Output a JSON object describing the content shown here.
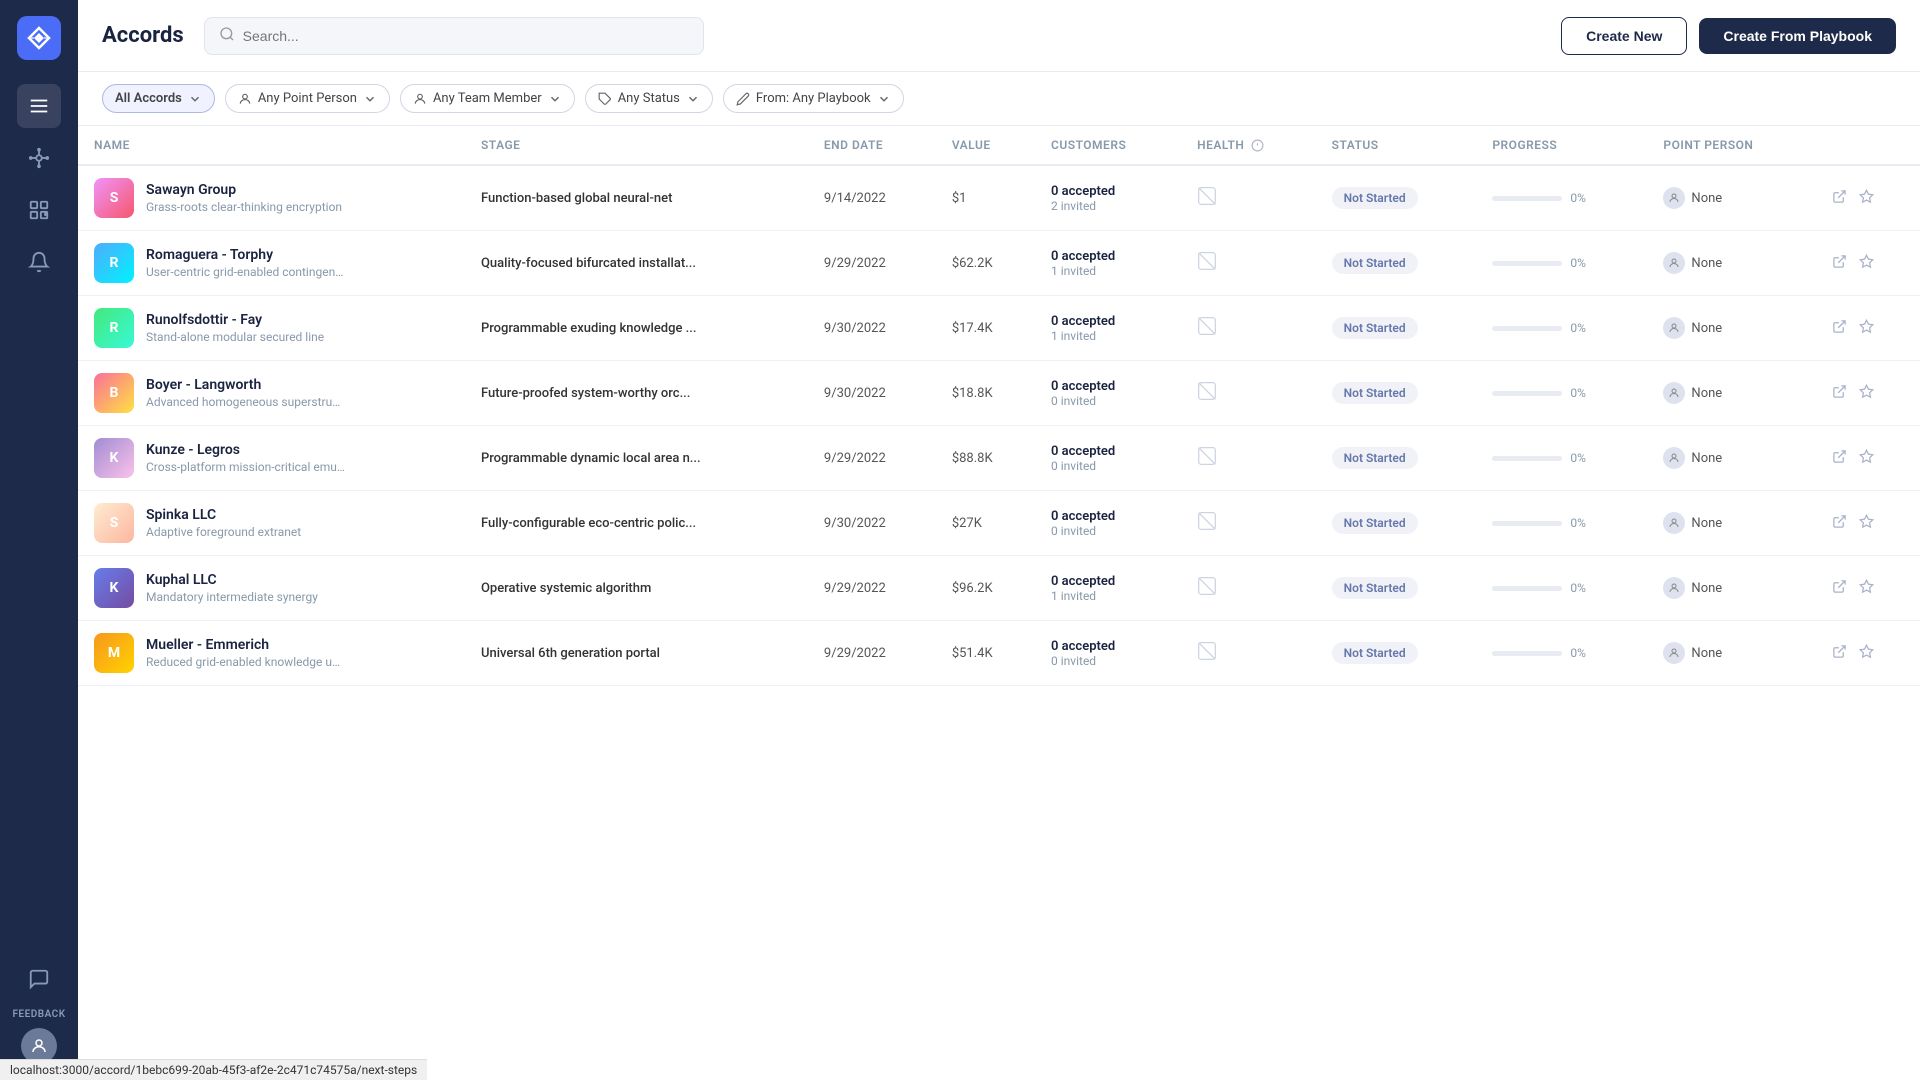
{
  "app": {
    "title": "Accords"
  },
  "header": {
    "title": "Accords",
    "search_placeholder": "Search...",
    "create_new_label": "Create New",
    "create_playbook_label": "Create From Playbook"
  },
  "filters": [
    {
      "id": "all-accords",
      "label": "All Accords",
      "active": true,
      "has_chevron": true
    },
    {
      "id": "point-person",
      "label": "Any Point Person",
      "has_icon": "person",
      "has_chevron": true
    },
    {
      "id": "team-member",
      "label": "Any Team Member",
      "has_icon": "person",
      "has_chevron": true
    },
    {
      "id": "status",
      "label": "Any Status",
      "has_icon": "tag",
      "has_chevron": true
    },
    {
      "id": "playbook",
      "label": "From: Any Playbook",
      "has_icon": "playbook",
      "has_chevron": true
    }
  ],
  "table": {
    "columns": [
      "Name",
      "Stage",
      "End Date",
      "Value",
      "Customers",
      "Health",
      "Status",
      "Progress",
      "Point Person"
    ],
    "rows": [
      {
        "id": 1,
        "name": "Sawayn Group",
        "subtitle": "Grass-roots clear-thinking encryption",
        "stage": "Function-based global neural-net",
        "end_date": "9/14/2022",
        "value": "$1",
        "customers_accepted": "0 accepted",
        "customers_invited": "2 invited",
        "status": "Not Started",
        "progress": 0,
        "point_person": "None",
        "avatar_class": "avatar-1"
      },
      {
        "id": 2,
        "name": "Romaguera - Torphy",
        "subtitle": "User-centric grid-enabled contingency",
        "stage": "Quality-focused bifurcated installat...",
        "end_date": "9/29/2022",
        "value": "$62.2K",
        "customers_accepted": "0 accepted",
        "customers_invited": "1 invited",
        "status": "Not Started",
        "progress": 0,
        "point_person": "None",
        "avatar_class": "avatar-2"
      },
      {
        "id": 3,
        "name": "Runolfsdottir - Fay",
        "subtitle": "Stand-alone modular secured line",
        "stage": "Programmable exuding knowledge ...",
        "end_date": "9/30/2022",
        "value": "$17.4K",
        "customers_accepted": "0 accepted",
        "customers_invited": "1 invited",
        "status": "Not Started",
        "progress": 0,
        "point_person": "None",
        "avatar_class": "avatar-3"
      },
      {
        "id": 4,
        "name": "Boyer - Langworth",
        "subtitle": "Advanced homogeneous superstructure",
        "stage": "Future-proofed system-worthy orc...",
        "end_date": "9/30/2022",
        "value": "$18.8K",
        "customers_accepted": "0 accepted",
        "customers_invited": "0 invited",
        "status": "Not Started",
        "progress": 0,
        "point_person": "None",
        "avatar_class": "avatar-4"
      },
      {
        "id": 5,
        "name": "Kunze - Legros",
        "subtitle": "Cross-platform mission-critical emulation",
        "stage": "Programmable dynamic local area n...",
        "end_date": "9/29/2022",
        "value": "$88.8K",
        "customers_accepted": "0 accepted",
        "customers_invited": "0 invited",
        "status": "Not Started",
        "progress": 0,
        "point_person": "None",
        "avatar_class": "avatar-5"
      },
      {
        "id": 6,
        "name": "Spinka LLC",
        "subtitle": "Adaptive foreground extranet",
        "stage": "Fully-configurable eco-centric polic...",
        "end_date": "9/30/2022",
        "value": "$27K",
        "customers_accepted": "0 accepted",
        "customers_invited": "0 invited",
        "status": "Not Started",
        "progress": 0,
        "point_person": "None",
        "avatar_class": "avatar-6"
      },
      {
        "id": 7,
        "name": "Kuphal LLC",
        "subtitle": "Mandatory intermediate synergy",
        "stage": "Operative systemic algorithm",
        "end_date": "9/29/2022",
        "value": "$96.2K",
        "customers_accepted": "0 accepted",
        "customers_invited": "1 invited",
        "status": "Not Started",
        "progress": 0,
        "point_person": "None",
        "avatar_class": "avatar-7"
      },
      {
        "id": 8,
        "name": "Mueller - Emmerich",
        "subtitle": "Reduced grid-enabled knowledge user",
        "stage": "Universal 6th generation portal",
        "end_date": "9/29/2022",
        "value": "$51.4K",
        "customers_accepted": "0 accepted",
        "customers_invited": "0 invited",
        "status": "Not Started",
        "progress": 0,
        "point_person": "None",
        "avatar_class": "avatar-8"
      }
    ]
  },
  "sidebar": {
    "items": [
      {
        "id": "menu",
        "icon": "menu"
      },
      {
        "id": "network",
        "icon": "network"
      },
      {
        "id": "grid",
        "icon": "grid"
      },
      {
        "id": "bell",
        "icon": "bell"
      }
    ],
    "feedback_label": "FEEDBACK"
  },
  "url_bar": {
    "url": "localhost:3000/accord/1bebc699-20ab-45f3-af2e-2c471c74575a/next-steps"
  },
  "colors": {
    "sidebar_bg": "#1e2a4a",
    "accent": "#4a6cf7",
    "status_not_started_bg": "#f0f2f8",
    "status_not_started_text": "#6677aa"
  }
}
